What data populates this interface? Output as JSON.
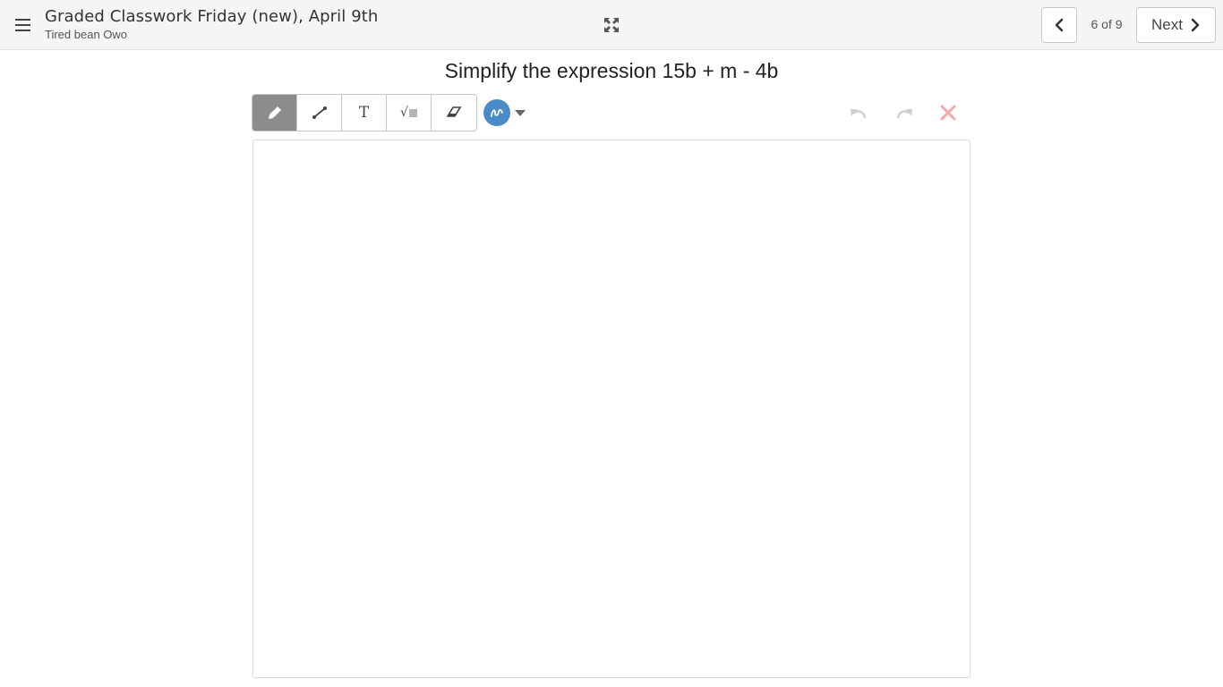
{
  "header": {
    "menu_icon": "hamburger-menu-icon",
    "title": "Graded Classwork Friday (new), April 9th",
    "subtitle": "Tired bean Owo",
    "expand_icon": "expand-arrows-icon",
    "page_indicator": "6 of 9",
    "next_label": "Next",
    "prev_icon": "chevron-left-icon",
    "next_icon": "chevron-right-icon"
  },
  "question": {
    "text": "Simplify the expression 15b + m - 4b"
  },
  "toolbar": {
    "tools": [
      {
        "name": "pen",
        "icon": "pencil-icon",
        "active": true
      },
      {
        "name": "line",
        "icon": "line-icon",
        "active": false
      },
      {
        "name": "text",
        "icon": "text-icon",
        "label": "T",
        "active": false
      },
      {
        "name": "math",
        "icon": "square-root-icon",
        "label": "√",
        "active": false
      },
      {
        "name": "eraser",
        "icon": "eraser-icon",
        "active": false
      }
    ],
    "color_icon": "squiggle-icon",
    "color": "#4a8bc7",
    "undo_icon": "undo-icon",
    "redo_icon": "redo-icon",
    "clear_icon": "close-icon",
    "clear_color": "#f2a9a9"
  }
}
